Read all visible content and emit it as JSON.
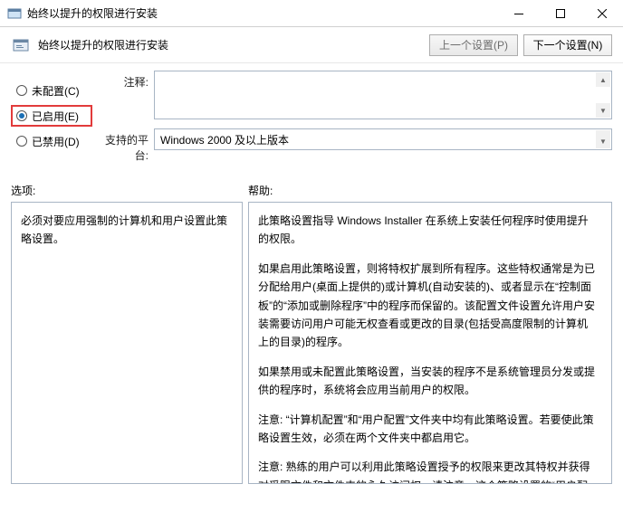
{
  "window": {
    "title": "始终以提升的权限进行安装"
  },
  "toolbar": {
    "name": "始终以提升的权限进行安装",
    "prev": "上一个设置(P)",
    "next": "下一个设置(N)"
  },
  "state": {
    "not_configured": "未配置(C)",
    "enabled": "已启用(E)",
    "disabled": "已禁用(D)",
    "selected": "enabled"
  },
  "fields": {
    "comment_label": "注释:",
    "comment_value": "",
    "platform_label": "支持的平台:",
    "platform_value": "Windows 2000 及以上版本"
  },
  "labels": {
    "options": "选项:",
    "help": "帮助:"
  },
  "options_text": "必须对要应用强制的计算机和用户设置此策略设置。",
  "help_paragraphs": [
    "此策略设置指导 Windows Installer 在系统上安装任何程序时使用提升的权限。",
    "如果启用此策略设置，则将特权扩展到所有程序。这些特权通常是为已分配给用户(桌面上提供的)或计算机(自动安装的)、或者显示在“控制面板”的“添加或删除程序”中的程序而保留的。该配置文件设置允许用户安装需要访问用户可能无权查看或更改的目录(包括受高度限制的计算机上的目录)的程序。",
    "如果禁用或未配置此策略设置，当安装的程序不是系统管理员分发或提供的程序时，系统将会应用当前用户的权限。",
    "注意: “计算机配置”和“用户配置”文件夹中均有此策略设置。若要使此策略设置生效，必须在两个文件夹中都启用它。",
    "注意: 熟练的用户可以利用此策略设置授予的权限来更改其特权并获得对受限文件和文件夹的永久访问权。请注意，这个策略设置的“用户配置”版本不一定安全。"
  ]
}
